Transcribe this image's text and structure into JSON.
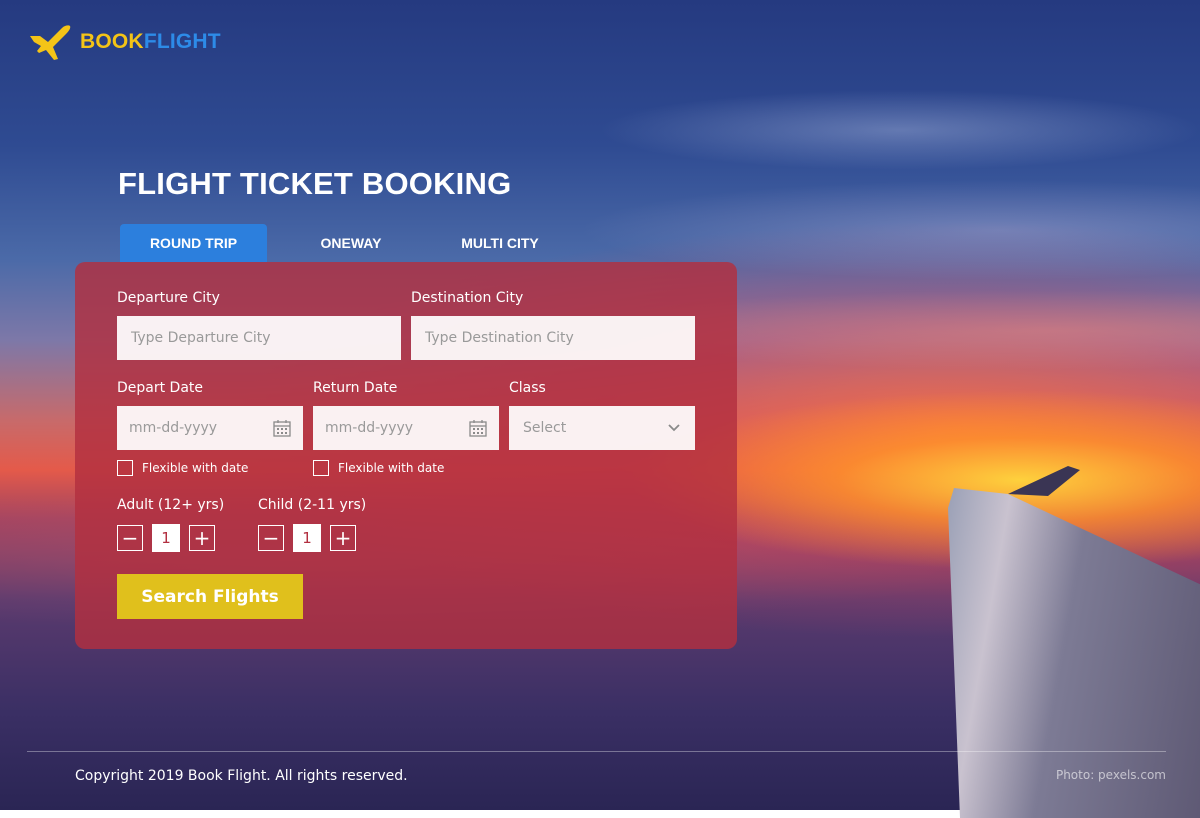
{
  "brand": {
    "name_part1": "BOOK",
    "name_part2": "FLIGHT",
    "color1": "#f4c417",
    "color2": "#2d8be8",
    "icon": "airplane-icon"
  },
  "page_title": "FLIGHT TICKET BOOKING",
  "tabs": [
    {
      "label": "ROUND TRIP",
      "active": true
    },
    {
      "label": "ONEWAY",
      "active": false
    },
    {
      "label": "MULTI CITY",
      "active": false
    }
  ],
  "form": {
    "departure_city": {
      "label": "Departure City",
      "placeholder": "Type Departure City"
    },
    "destination_city": {
      "label": "Destination City",
      "placeholder": "Type Destination City"
    },
    "depart_date": {
      "label": "Depart Date",
      "placeholder": "mm-dd-yyyy",
      "icon": "calendar-icon"
    },
    "return_date": {
      "label": "Return Date",
      "placeholder": "mm-dd-yyyy",
      "icon": "calendar-icon"
    },
    "class": {
      "label": "Class",
      "selected": "Select",
      "icon": "chevron-down-icon"
    },
    "flexible_depart": {
      "label": "Flexible with date",
      "checked": false
    },
    "flexible_return": {
      "label": "Flexible with date",
      "checked": false
    },
    "adult": {
      "label": "Adult (12+ yrs)",
      "value": "1",
      "minus": "−",
      "plus": "+"
    },
    "child": {
      "label": "Child (2-11 yrs)",
      "value": "1",
      "minus": "−",
      "plus": "+"
    },
    "search_button": "Search Flights"
  },
  "colors": {
    "panel": "#b23040",
    "tab_active": "#2c7fdd",
    "search_button": "#e0c01c"
  },
  "footer": {
    "copyright": "Copyright 2019 Book Flight. All rights reserved.",
    "photo_credit": "Photo: pexels.com"
  }
}
